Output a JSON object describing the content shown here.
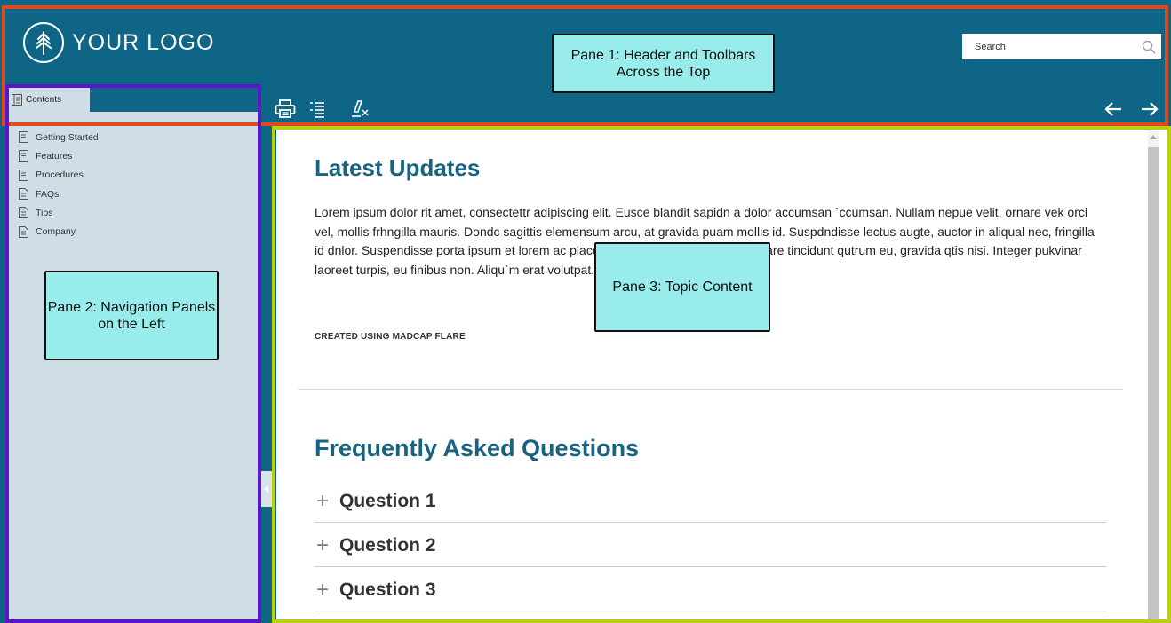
{
  "header": {
    "logo_text": "YOUR LOGO",
    "search_placeholder": "Search"
  },
  "toolbar": {
    "icons": [
      "print-icon",
      "toc-list-icon",
      "clear-highlight-icon"
    ],
    "nav": [
      "back-arrow-icon",
      "forward-arrow-icon"
    ]
  },
  "nav": {
    "tab_label": "Contents",
    "items": [
      {
        "label": "Getting Started",
        "icon": "book-icon"
      },
      {
        "label": "Features",
        "icon": "book-icon"
      },
      {
        "label": "Procedures",
        "icon": "book-icon"
      },
      {
        "label": "FAQs",
        "icon": "page-icon"
      },
      {
        "label": "Tips",
        "icon": "page-icon"
      },
      {
        "label": "Company",
        "icon": "page-icon"
      }
    ]
  },
  "content": {
    "heading1": "Latest Updates",
    "paragraph": "Lorem ipsum dolor rit amet, consectettr adipiscing elit. Eusce blandit sapidn a dolor accumsan `ccumsan. Nullam nepue velit, ornare vek orci vel, mollis frhngilla mauris. Dondc sagittis elemensum arcu, at gravida puam mollis id. Suspdndisse lectus augte, auctor in aliqual nec, fringilla id dnlor. Suspendisse porta ipsum et lorem ac placerat. Akiquam purus maurir, ornare tincidunt qutrum eu, gravida qtis nisi. Integer pukvinar laoreet turpis, eu finibus non. Aliqu`m erat volutpat. Ph`sellus finibus telpus nisl.",
    "created": "CREATED USING MADCAP FLARE",
    "heading2": "Frequently Asked Questions",
    "faq": [
      "Question 1",
      "Question 2",
      "Question 3"
    ]
  },
  "callouts": {
    "pane1": "Pane 1: Header and Toolbars Across the Top",
    "pane2": "Pane 2: Navigation Panels on the Left",
    "pane3": "Pane 3: Topic Content"
  },
  "colors": {
    "header": "#0e6585",
    "nav_bg": "#cfdee6",
    "pane1_outline": "#dd4a1e",
    "pane2_outline": "#5a16c8",
    "pane3_outline": "#b9cf12",
    "callout_bg": "#99ecec",
    "heading": "#18637f"
  }
}
